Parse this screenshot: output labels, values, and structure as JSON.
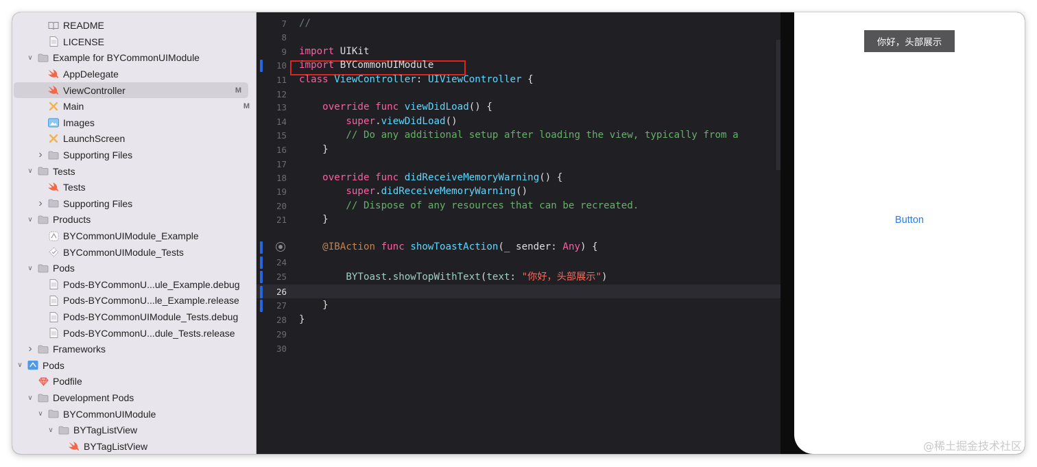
{
  "sidebar": {
    "items": [
      {
        "label": "README",
        "icon": "book-icon",
        "depth": 3,
        "disclosure": "",
        "badge": ""
      },
      {
        "label": "LICENSE",
        "icon": "document-icon",
        "depth": 3,
        "disclosure": "",
        "badge": ""
      },
      {
        "label": "Example for BYCommonUIModule",
        "icon": "folder-icon",
        "depth": 2,
        "disclosure": "open",
        "badge": ""
      },
      {
        "label": "AppDelegate",
        "icon": "swift-icon",
        "depth": 3,
        "disclosure": "",
        "badge": ""
      },
      {
        "label": "ViewController",
        "icon": "swift-icon",
        "depth": 3,
        "disclosure": "",
        "badge": "M",
        "selected": true
      },
      {
        "label": "Main",
        "icon": "storyboard-icon",
        "depth": 3,
        "disclosure": "",
        "badge": "M"
      },
      {
        "label": "Images",
        "icon": "asset-catalog-icon",
        "depth": 3,
        "disclosure": "",
        "badge": ""
      },
      {
        "label": "LaunchScreen",
        "icon": "storyboard-icon",
        "depth": 3,
        "disclosure": "",
        "badge": ""
      },
      {
        "label": "Supporting Files",
        "icon": "folder-icon",
        "depth": 3,
        "disclosure": "closed",
        "badge": ""
      },
      {
        "label": "Tests",
        "icon": "folder-icon",
        "depth": 2,
        "disclosure": "open",
        "badge": ""
      },
      {
        "label": "Tests",
        "icon": "swift-icon",
        "depth": 3,
        "disclosure": "",
        "badge": ""
      },
      {
        "label": "Supporting Files",
        "icon": "folder-icon",
        "depth": 3,
        "disclosure": "closed",
        "badge": ""
      },
      {
        "label": "Products",
        "icon": "folder-icon",
        "depth": 2,
        "disclosure": "open",
        "badge": ""
      },
      {
        "label": "BYCommonUIModule_Example",
        "icon": "app-icon",
        "depth": 3,
        "disclosure": "",
        "badge": ""
      },
      {
        "label": "BYCommonUIModule_Tests",
        "icon": "test-bundle-icon",
        "depth": 3,
        "disclosure": "",
        "badge": ""
      },
      {
        "label": "Pods",
        "icon": "folder-icon",
        "depth": 2,
        "disclosure": "open",
        "badge": ""
      },
      {
        "label": "Pods-BYCommonU...ule_Example.debug",
        "icon": "document-icon",
        "depth": 3,
        "disclosure": "",
        "badge": ""
      },
      {
        "label": "Pods-BYCommonU...le_Example.release",
        "icon": "document-icon",
        "depth": 3,
        "disclosure": "",
        "badge": ""
      },
      {
        "label": "Pods-BYCommonUIModule_Tests.debug",
        "icon": "document-icon",
        "depth": 3,
        "disclosure": "",
        "badge": ""
      },
      {
        "label": "Pods-BYCommonU...dule_Tests.release",
        "icon": "document-icon",
        "depth": 3,
        "disclosure": "",
        "badge": ""
      },
      {
        "label": "Frameworks",
        "icon": "folder-icon",
        "depth": 2,
        "disclosure": "closed",
        "badge": ""
      },
      {
        "label": "Pods",
        "icon": "project-icon",
        "depth": 1,
        "disclosure": "open",
        "badge": ""
      },
      {
        "label": "Podfile",
        "icon": "ruby-icon",
        "depth": 2,
        "disclosure": "",
        "badge": ""
      },
      {
        "label": "Development Pods",
        "icon": "folder-icon",
        "depth": 2,
        "disclosure": "open",
        "badge": ""
      },
      {
        "label": "BYCommonUIModule",
        "icon": "folder-icon",
        "depth": 3,
        "disclosure": "open",
        "badge": ""
      },
      {
        "label": "BYTagListView",
        "icon": "folder-icon",
        "depth": 4,
        "disclosure": "open",
        "badge": ""
      },
      {
        "label": "BYTagListView",
        "icon": "swift-icon",
        "depth": 5,
        "disclosure": "",
        "badge": ""
      }
    ]
  },
  "editor": {
    "lines": [
      {
        "no": "7",
        "tokens": [
          [
            "//",
            "com"
          ]
        ]
      },
      {
        "no": "8",
        "tokens": []
      },
      {
        "no": "9",
        "tokens": [
          [
            "import",
            "kw"
          ],
          [
            " ",
            "plain"
          ],
          [
            "UIKit",
            "plain"
          ]
        ]
      },
      {
        "no": "10",
        "tokens": [
          [
            "import",
            "kw"
          ],
          [
            " ",
            "plain"
          ],
          [
            "BYCommonUIModule",
            "plain"
          ]
        ],
        "changed": true
      },
      {
        "no": "11",
        "tokens": [
          [
            "class",
            "kw"
          ],
          [
            " ",
            "plain"
          ],
          [
            "ViewController",
            "decl"
          ],
          [
            ": ",
            "plain"
          ],
          [
            "UIViewController",
            "cls"
          ],
          [
            " {",
            "plain"
          ]
        ]
      },
      {
        "no": "12",
        "tokens": []
      },
      {
        "no": "13",
        "tokens": [
          [
            "    ",
            "plain"
          ],
          [
            "override",
            "kw"
          ],
          [
            " ",
            "plain"
          ],
          [
            "func",
            "kw"
          ],
          [
            " ",
            "plain"
          ],
          [
            "viewDidLoad",
            "decl"
          ],
          [
            "() {",
            "plain"
          ]
        ]
      },
      {
        "no": "14",
        "tokens": [
          [
            "        ",
            "plain"
          ],
          [
            "super",
            "kw"
          ],
          [
            ".",
            "plain"
          ],
          [
            "viewDidLoad",
            "cls"
          ],
          [
            "()",
            "plain"
          ]
        ]
      },
      {
        "no": "15",
        "tokens": [
          [
            "        ",
            "plain"
          ],
          [
            "// Do any additional setup after loading the view, typically from a",
            "comment"
          ]
        ]
      },
      {
        "no": "16",
        "tokens": [
          [
            "    }",
            "plain"
          ]
        ]
      },
      {
        "no": "17",
        "tokens": []
      },
      {
        "no": "18",
        "tokens": [
          [
            "    ",
            "plain"
          ],
          [
            "override",
            "kw"
          ],
          [
            " ",
            "plain"
          ],
          [
            "func",
            "kw"
          ],
          [
            " ",
            "plain"
          ],
          [
            "didReceiveMemoryWarning",
            "decl"
          ],
          [
            "() {",
            "plain"
          ]
        ]
      },
      {
        "no": "19",
        "tokens": [
          [
            "        ",
            "plain"
          ],
          [
            "super",
            "kw"
          ],
          [
            ".",
            "plain"
          ],
          [
            "didReceiveMemoryWarning",
            "cls"
          ],
          [
            "()",
            "plain"
          ]
        ]
      },
      {
        "no": "20",
        "tokens": [
          [
            "        ",
            "plain"
          ],
          [
            "// Dispose of any resources that can be recreated.",
            "comment"
          ]
        ]
      },
      {
        "no": "21",
        "tokens": [
          [
            "    }",
            "plain"
          ]
        ]
      },
      {
        "no": "",
        "tokens": []
      },
      {
        "no": "",
        "tokens": [
          [
            "    ",
            "plain"
          ],
          [
            "@IBAction",
            "attr"
          ],
          [
            " ",
            "plain"
          ],
          [
            "func",
            "kw"
          ],
          [
            " ",
            "plain"
          ],
          [
            "showToastAction",
            "decl"
          ],
          [
            "(_ sender: ",
            "plain"
          ],
          [
            "Any",
            "kw"
          ],
          [
            ") {",
            "plain"
          ]
        ],
        "breakpoint": true,
        "changed": true
      },
      {
        "no": "24",
        "tokens": [],
        "changed": true
      },
      {
        "no": "25",
        "tokens": [
          [
            "        ",
            "plain"
          ],
          [
            "BYToast",
            "name"
          ],
          [
            ".",
            "plain"
          ],
          [
            "showTopWithText",
            "name"
          ],
          [
            "(",
            "plain"
          ],
          [
            "text",
            "name"
          ],
          [
            ": ",
            "plain"
          ],
          [
            "\"你好，头部展示\"",
            "str"
          ],
          [
            ")",
            "plain"
          ]
        ],
        "changed": true
      },
      {
        "no": "26",
        "tokens": [],
        "current": true,
        "changed": true
      },
      {
        "no": "27",
        "tokens": [
          [
            "    }",
            "plain"
          ]
        ],
        "changed": true
      },
      {
        "no": "28",
        "tokens": [
          [
            "}",
            "plain"
          ]
        ]
      },
      {
        "no": "29",
        "tokens": []
      },
      {
        "no": "30",
        "tokens": []
      }
    ]
  },
  "simulator": {
    "toast_text": "你好，头部展示",
    "button_label": "Button"
  },
  "watermark": "@稀土掘金技术社区",
  "colors": {
    "sidebar_bg": "#e9e5ed",
    "editor_bg": "#1f1f24",
    "keyword": "#fc5fa3",
    "string": "#fc6a5d",
    "comment": "#67b06a",
    "change_bar": "#2467e0",
    "highlight_box": "#e0251e",
    "ios_button": "#2a7ae2"
  }
}
